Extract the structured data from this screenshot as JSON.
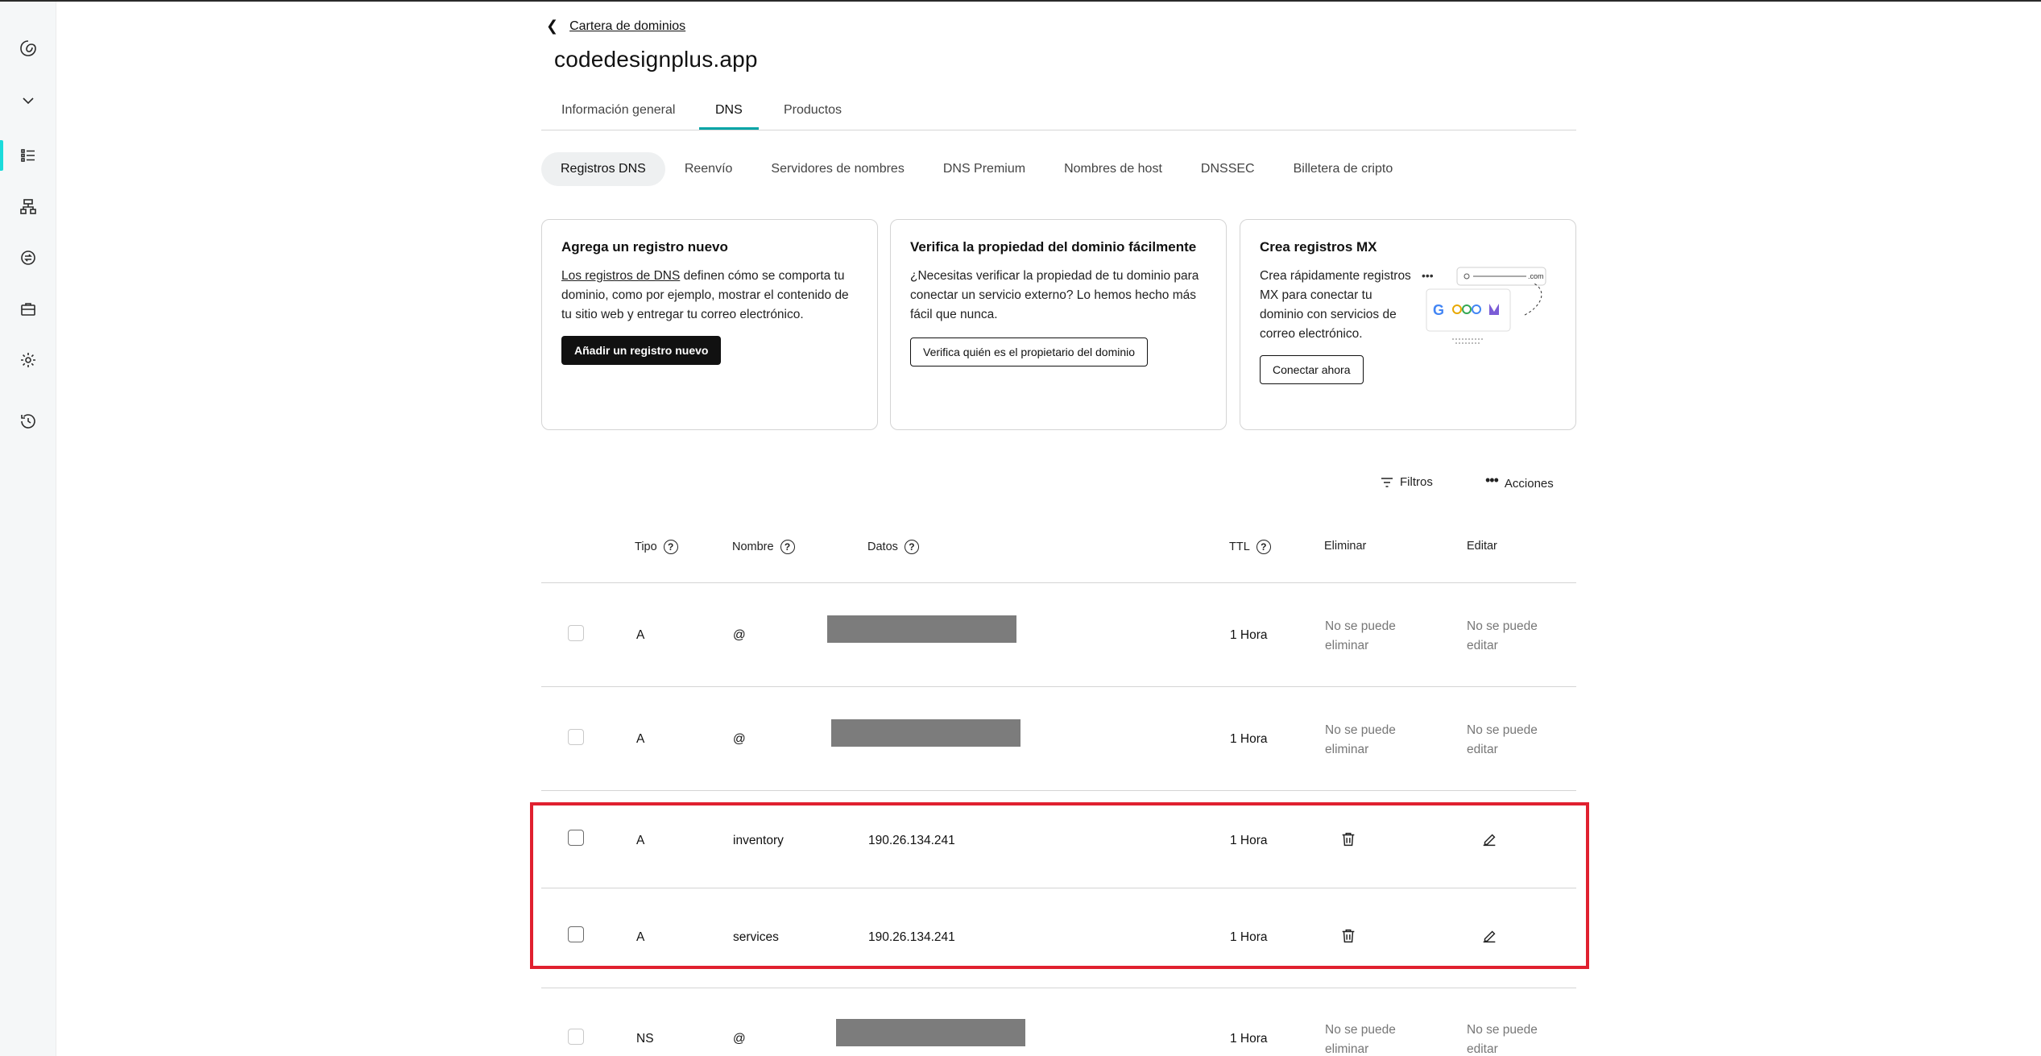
{
  "breadcrumb": {
    "label": "Cartera de dominios"
  },
  "page": {
    "title": "codedesignplus.app"
  },
  "tabs": [
    {
      "label": "Información general",
      "active": false
    },
    {
      "label": "DNS",
      "active": true
    },
    {
      "label": "Productos",
      "active": false
    }
  ],
  "subtabs": [
    {
      "label": "Registros DNS",
      "active": true
    },
    {
      "label": "Reenvío",
      "active": false
    },
    {
      "label": "Servidores de nombres",
      "active": false
    },
    {
      "label": "DNS Premium",
      "active": false
    },
    {
      "label": "Nombres de host",
      "active": false
    },
    {
      "label": "DNSSEC",
      "active": false
    },
    {
      "label": "Billetera de cripto",
      "active": false
    }
  ],
  "cards": {
    "add": {
      "title": "Agrega un registro nuevo",
      "link": "Los registros de DNS",
      "text": " definen cómo se comporta tu dominio, como por ejemplo, mostrar el contenido de tu sitio web y entregar tu correo electrónico.",
      "button": "Añadir un registro nuevo"
    },
    "verify": {
      "title": "Verifica la propiedad del dominio fácilmente",
      "text": "¿Necesitas verificar la propiedad de tu dominio para conectar un servicio externo? Lo hemos hecho más fácil que nunca.",
      "button": "Verifica quién es el propietario del dominio"
    },
    "mx": {
      "title": "Crea registros MX",
      "text": "Crea rápidamente registros MX para conectar tu dominio con servicios de correo electrónico.",
      "button": "Conectar ahora",
      "illustration_label": ".com"
    }
  },
  "toolbar": {
    "filters": "Filtros",
    "actions": "Acciones"
  },
  "table": {
    "headers": {
      "type": "Tipo",
      "name": "Nombre",
      "data": "Datos",
      "ttl": "TTL",
      "delete": "Eliminar",
      "edit": "Editar"
    },
    "cannot_delete": "No se puede eliminar",
    "cannot_edit": "No se puede editar",
    "rows": [
      {
        "type": "A",
        "name": "@",
        "data": "",
        "ttl": "1 Hora",
        "editable": false
      },
      {
        "type": "A",
        "name": "@",
        "data": "",
        "ttl": "1 Hora",
        "editable": false
      },
      {
        "type": "A",
        "name": "inventory",
        "data": "190.26.134.241",
        "ttl": "1 Hora",
        "editable": true
      },
      {
        "type": "A",
        "name": "services",
        "data": "190.26.134.241",
        "ttl": "1 Hora",
        "editable": true
      },
      {
        "type": "NS",
        "name": "@",
        "data": "",
        "ttl": "1 Hora",
        "editable": false
      }
    ]
  },
  "colors": {
    "accent": "#00a4a6",
    "sidebar_active": "#1bdbdb",
    "highlight": "#e0202f",
    "dark_button": "#111111"
  }
}
